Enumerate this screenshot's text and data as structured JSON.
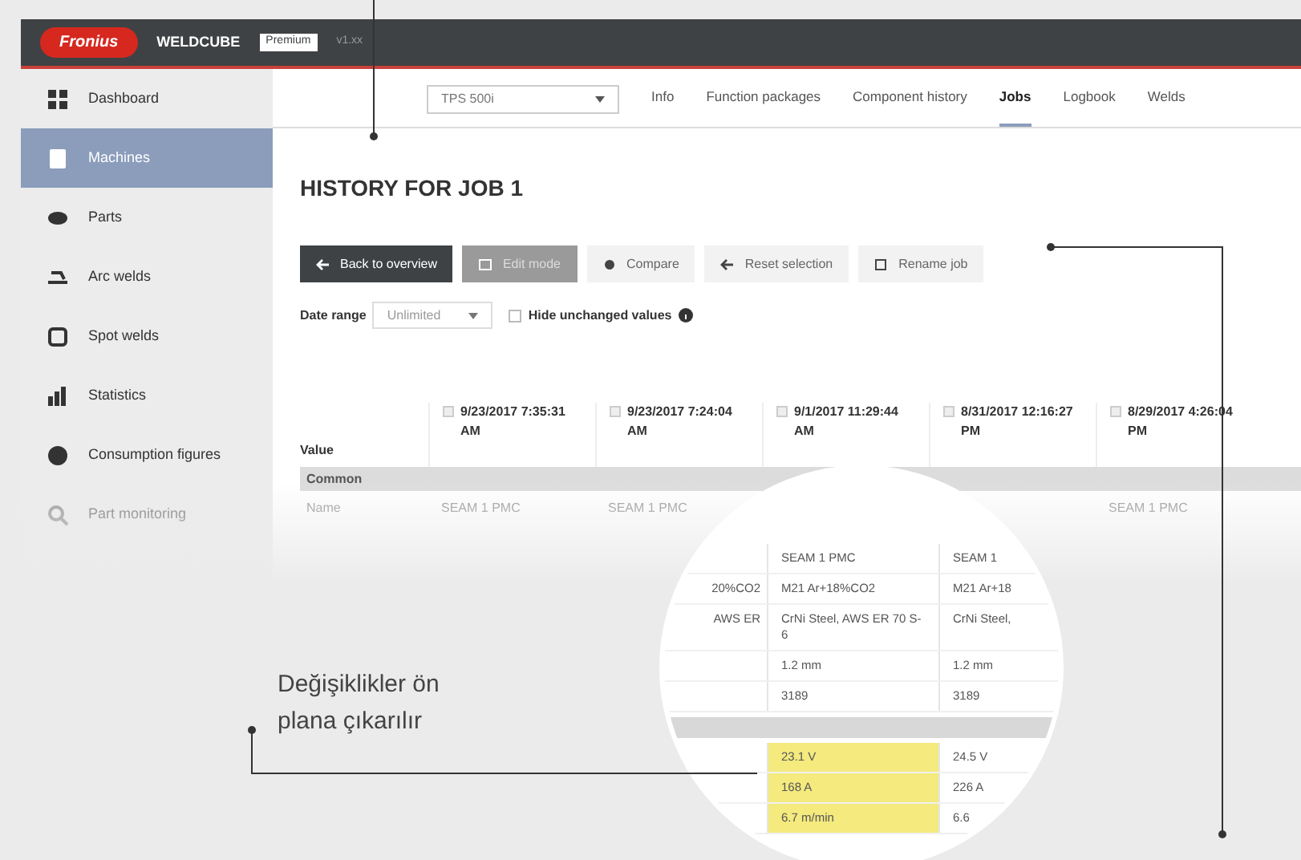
{
  "header": {
    "logo": "Fronius",
    "product": "WELDCUBE",
    "badge": "Premium",
    "version": "v1.xx"
  },
  "sidebar": {
    "items": [
      {
        "label": "Dashboard",
        "selected": false,
        "disabled": false
      },
      {
        "label": "Machines",
        "selected": true,
        "disabled": false
      },
      {
        "label": "Parts",
        "selected": false,
        "disabled": false
      },
      {
        "label": "Arc welds",
        "selected": false,
        "disabled": false
      },
      {
        "label": "Spot welds",
        "selected": false,
        "disabled": false
      },
      {
        "label": "Statistics",
        "selected": false,
        "disabled": false
      },
      {
        "label": "Consumption figures",
        "selected": false,
        "disabled": false
      },
      {
        "label": "Part monitoring",
        "selected": false,
        "disabled": true
      }
    ]
  },
  "machine_select": {
    "value": "TPS 500i"
  },
  "tabs": [
    {
      "label": "Info",
      "selected": false
    },
    {
      "label": "Function packages",
      "selected": false
    },
    {
      "label": "Component history",
      "selected": false
    },
    {
      "label": "Jobs",
      "selected": true
    },
    {
      "label": "Logbook",
      "selected": false
    },
    {
      "label": "Welds",
      "selected": false
    }
  ],
  "title": "HISTORY FOR JOB 1",
  "buttons": [
    {
      "label": "Back to overview",
      "kind": "primary",
      "disabled": false
    },
    {
      "label": "Edit mode",
      "kind": "primary",
      "disabled": true
    },
    {
      "label": "Compare",
      "kind": "secondary",
      "disabled": false
    },
    {
      "label": "Reset selection",
      "kind": "secondary",
      "disabled": false
    },
    {
      "label": "Rename job",
      "kind": "secondary",
      "disabled": false
    }
  ],
  "date_range": {
    "label": "Date range",
    "value": "Unlimited"
  },
  "hide_unchanged": {
    "label": "Hide unchanged values",
    "checked": false
  },
  "table": {
    "columns": [
      {
        "label": "Value"
      },
      {
        "label": "9/23/2017 7:35:31 AM",
        "checked": false
      },
      {
        "label": "9/23/2017 7:24:04 AM",
        "checked": false
      },
      {
        "label": "9/1/2017 11:29:44 AM",
        "checked": false
      },
      {
        "label": "8/31/2017 12:16:27 PM",
        "checked": false
      },
      {
        "label": "8/29/2017 4:26:04 PM",
        "checked": false
      }
    ],
    "group": "Common",
    "rows": [
      {
        "cells": [
          "Name",
          "SEAM 1 PMC",
          "SEAM 1 PMC",
          "",
          "",
          "SEAM 1 PMC"
        ]
      }
    ]
  },
  "magnifier": {
    "rows": [
      {
        "kind": "row",
        "cells": [
          {
            "text": "",
            "changed": false
          },
          {
            "text": "SEAM 1 PMC",
            "changed": false
          },
          {
            "text": "SEAM 1",
            "changed": false
          }
        ]
      },
      {
        "kind": "row",
        "cells": [
          {
            "text": "20%CO2",
            "changed": false
          },
          {
            "text": "M21 Ar+18%CO2",
            "changed": false
          },
          {
            "text": "M21 Ar+18",
            "changed": false
          }
        ]
      },
      {
        "kind": "row",
        "cells": [
          {
            "text": "AWS ER",
            "changed": false
          },
          {
            "text": "CrNi Steel, AWS ER 70 S-6",
            "changed": false
          },
          {
            "text": "CrNi Steel,",
            "changed": false
          }
        ]
      },
      {
        "kind": "row",
        "cells": [
          {
            "text": "",
            "changed": false
          },
          {
            "text": "1.2 mm",
            "changed": false
          },
          {
            "text": "1.2 mm",
            "changed": false
          }
        ]
      },
      {
        "kind": "row",
        "cells": [
          {
            "text": "",
            "changed": false
          },
          {
            "text": "3189",
            "changed": false
          },
          {
            "text": "3189",
            "changed": false
          }
        ]
      },
      {
        "kind": "group",
        "cells": []
      },
      {
        "kind": "row",
        "cells": [
          {
            "text": "",
            "changed": false
          },
          {
            "text": "23.1 V",
            "changed": true
          },
          {
            "text": "24.5 V",
            "changed": false
          }
        ]
      },
      {
        "kind": "row",
        "cells": [
          {
            "text": "",
            "changed": false
          },
          {
            "text": "168 A",
            "changed": true
          },
          {
            "text": "226 A",
            "changed": false
          }
        ]
      },
      {
        "kind": "row",
        "cells": [
          {
            "text": "",
            "changed": false
          },
          {
            "text": "6.7 m/min",
            "changed": true
          },
          {
            "text": "6.6",
            "changed": false
          }
        ]
      }
    ]
  },
  "annotation": "Değişiklikler ön plana çıkarılır"
}
